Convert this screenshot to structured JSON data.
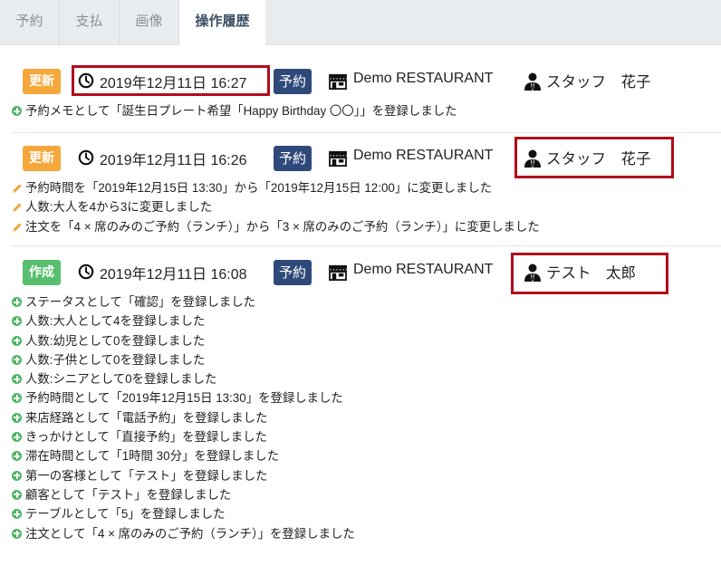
{
  "tabs": [
    {
      "label": "予約"
    },
    {
      "label": "支払"
    },
    {
      "label": "画像"
    },
    {
      "label": "操作履歴"
    }
  ],
  "entries": [
    {
      "badge": "更新",
      "datetime": "2019年12月11日 16:27",
      "tag": "予約",
      "shop": "Demo RESTAURANT",
      "staff": "スタッフ　花子",
      "lines": [
        "予約メモとして「誕生日プレート希望「Happy Birthday 〇〇」」を登録しました"
      ]
    },
    {
      "badge": "更新",
      "datetime": "2019年12月11日 16:26",
      "tag": "予約",
      "shop": "Demo RESTAURANT",
      "staff": "スタッフ　花子",
      "lines": [
        "予約時間を「2019年12月15日 13:30」から「2019年12月15日 12:00」に変更しました",
        "人数:大人を4から3に変更しました",
        "注文を「4 × 席のみのご予約（ランチ）」から「3 × 席のみのご予約（ランチ）」に変更しました"
      ]
    },
    {
      "badge": "作成",
      "datetime": "2019年12月11日 16:08",
      "tag": "予約",
      "shop": "Demo RESTAURANT",
      "staff": "テスト　太郎",
      "lines": [
        "ステータスとして「確認」を登録しました",
        "人数:大人として4を登録しました",
        "人数:幼児として0を登録しました",
        "人数:子供として0を登録しました",
        "人数:シニアとして0を登録しました",
        "予約時間として「2019年12月15日 13:30」を登録しました",
        "来店経路として「電話予約」を登録しました",
        "きっかけとして「直接予約」を登録しました",
        "滞在時間として「1時間 30分」を登録しました",
        "第一の客様として「テスト」を登録しました",
        "顧客として「テスト」を登録しました",
        "テーブルとして「5」を登録しました",
        "注文として「4 × 席のみのご予約（ランチ）」を登録しました"
      ]
    }
  ],
  "colors": {
    "update_badge": "#f5a73b",
    "create_badge": "#58bf6e",
    "reservation_tag": "#2f4a7a",
    "highlight_box": "#b10d1b",
    "plus_icon": "#4fb665",
    "pencil_icon": "#f0a030"
  }
}
